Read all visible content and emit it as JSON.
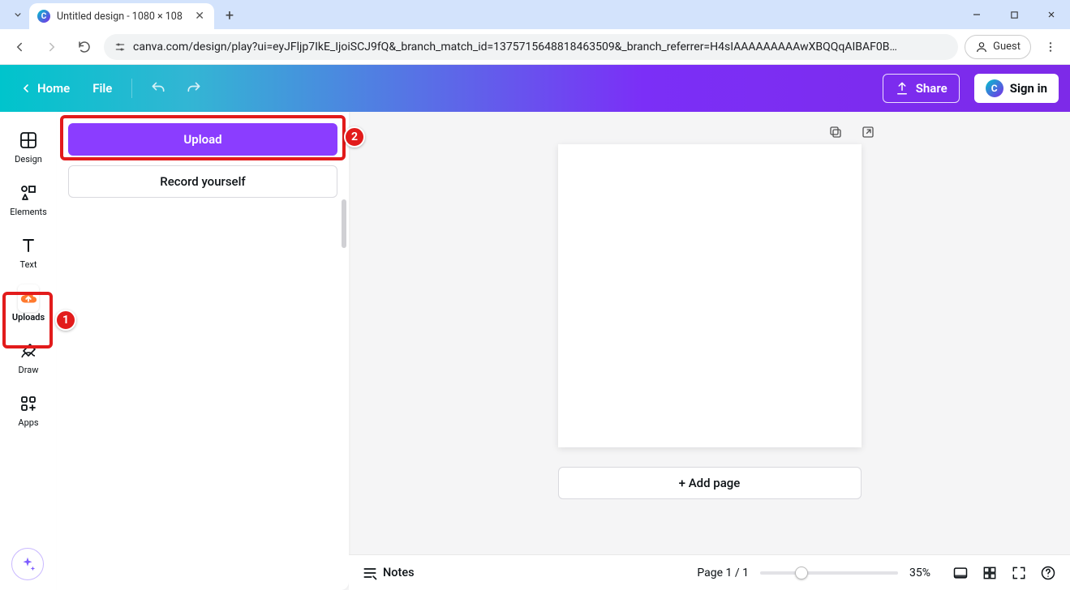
{
  "browser": {
    "tab_title": "Untitled design - 1080 × 108",
    "url": "canva.com/design/play?ui=eyJFljp7IkE_IjoiSCJ9fQ&_branch_match_id=1375715648818463509&_branch_referrer=H4sIAAAAAAAAAwXBQQqAIBAF0B…",
    "guest_label": "Guest"
  },
  "header": {
    "home_label": "Home",
    "file_label": "File",
    "share_label": "Share",
    "signin_label": "Sign in"
  },
  "rail": {
    "items": [
      {
        "label": "Design",
        "icon": "design"
      },
      {
        "label": "Elements",
        "icon": "elements"
      },
      {
        "label": "Text",
        "icon": "text"
      },
      {
        "label": "Uploads",
        "icon": "uploads"
      },
      {
        "label": "Draw",
        "icon": "draw"
      },
      {
        "label": "Apps",
        "icon": "apps"
      }
    ],
    "active_index": 3
  },
  "panel": {
    "upload_label": "Upload",
    "record_label": "Record yourself"
  },
  "canvas": {
    "add_page_label": "+ Add page"
  },
  "bottom": {
    "notes_label": "Notes",
    "page_indicator": "Page 1 / 1",
    "zoom_percent": "35%"
  },
  "annotations": {
    "badge1": "1",
    "badge2": "2"
  }
}
